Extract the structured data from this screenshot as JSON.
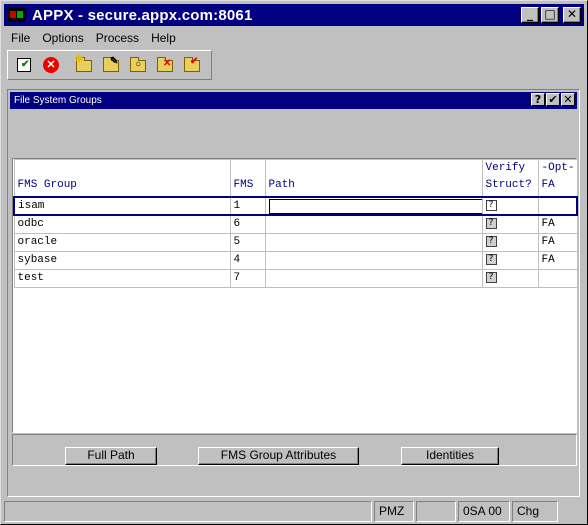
{
  "window": {
    "title": "APPX - secure.appx.com:8061"
  },
  "menu": [
    "File",
    "Options",
    "Process",
    "Help"
  ],
  "toolbar": [
    {
      "icon": "check-doc-icon"
    },
    {
      "icon": "cancel-icon"
    },
    {
      "icon": "new-folder-icon"
    },
    {
      "icon": "edit-folder-icon"
    },
    {
      "icon": "search-folder-icon"
    },
    {
      "icon": "delete-folder-icon"
    },
    {
      "icon": "check-folder-icon"
    }
  ],
  "dialog": {
    "title": "File System Groups",
    "buttons": [
      "?",
      "✔",
      "✕"
    ]
  },
  "table": {
    "headers": {
      "group": "FMS Group",
      "fms": "FMS",
      "path": "Path",
      "verify_top": "Verify",
      "verify_bottom": "Struct?",
      "opt_top": "-Opt-",
      "opt_bottom": "FA"
    },
    "rows": [
      {
        "group": "isam",
        "fms": "1",
        "path": "",
        "verify": "?",
        "opt": ""
      },
      {
        "group": "odbc",
        "fms": "6",
        "path": "",
        "verify": "?",
        "opt": "FA"
      },
      {
        "group": "oracle",
        "fms": "5",
        "path": "",
        "verify": "?",
        "opt": "FA"
      },
      {
        "group": "sybase",
        "fms": "4",
        "path": "",
        "verify": "?",
        "opt": "FA"
      },
      {
        "group": "test",
        "fms": "7",
        "path": "",
        "verify": "?",
        "opt": ""
      }
    ]
  },
  "actions": {
    "full_path": "Full Path",
    "fms_group_attributes": "FMS Group Attributes",
    "identities": "Identities"
  },
  "status": {
    "cell1": "",
    "cell2": "PMZ",
    "cell3": "",
    "cell4": "0SA 00",
    "cell5": "Chg"
  }
}
